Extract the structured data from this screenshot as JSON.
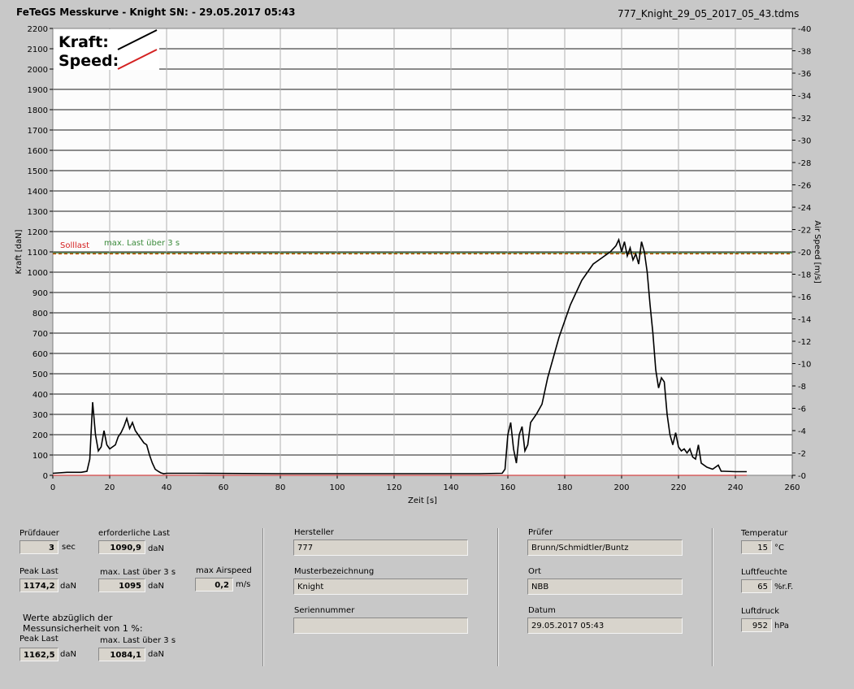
{
  "header": {
    "title": "FeTeGS Messkurve - Knight  SN:  - 29.05.2017 05:43",
    "filename": "777_Knight_29_05_2017_05_43.tdms"
  },
  "legend": {
    "kraft": "Kraft:",
    "speed": "Speed:"
  },
  "annotations": {
    "sollast": "Solllast",
    "maxlast": "max. Last über  3 s"
  },
  "colors": {
    "kraft": "#000000",
    "speed": "#d42020",
    "sollast": "#c84a00",
    "maxlast": "#3a8a3a"
  },
  "chart_data": {
    "type": "line",
    "xlabel": "Zeit [s]",
    "ylabel": "Kraft [daN]",
    "y2label": "Air Speed [m/s]",
    "xlim": [
      0,
      260
    ],
    "ylim": [
      0,
      2200
    ],
    "y2lim": [
      0,
      40
    ],
    "x_ticks": [
      "0",
      "20",
      "40",
      "60",
      "80",
      "100",
      "120",
      "140",
      "160",
      "180",
      "200",
      "220",
      "240",
      "260"
    ],
    "y_ticks": [
      "0",
      "100",
      "200",
      "300",
      "400",
      "500",
      "600",
      "700",
      "800",
      "900",
      "1000",
      "1100",
      "1200",
      "1300",
      "1400",
      "1500",
      "1600",
      "1700",
      "1800",
      "1900",
      "2000",
      "2100",
      "2200"
    ],
    "y2_ticks": [
      "0",
      "2",
      "4",
      "6",
      "8",
      "10",
      "12",
      "14",
      "16",
      "18",
      "20",
      "22",
      "24",
      "26",
      "28",
      "30",
      "32",
      "34",
      "36",
      "38",
      "40"
    ],
    "grid": true,
    "sollast": 1090.9,
    "maxlast": 1095,
    "series": [
      {
        "name": "Kraft",
        "axis": "left",
        "x": [
          0,
          5,
          10,
          12,
          13,
          14,
          15,
          16,
          17,
          18,
          19,
          20,
          21,
          22,
          23,
          24,
          25,
          26,
          27,
          28,
          29,
          30,
          31,
          32,
          33,
          34,
          35,
          36,
          37,
          38,
          39,
          40,
          50,
          80,
          120,
          150,
          158,
          159,
          160,
          161,
          162,
          163,
          164,
          165,
          166,
          167,
          168,
          170,
          172,
          174,
          176,
          178,
          180,
          182,
          184,
          186,
          188,
          190,
          192,
          194,
          196,
          198,
          199,
          200,
          201,
          202,
          203,
          204,
          205,
          206,
          207,
          208,
          209,
          210,
          211,
          212,
          213,
          214,
          215,
          216,
          217,
          218,
          219,
          220,
          221,
          222,
          223,
          224,
          225,
          226,
          227,
          228,
          230,
          232,
          234,
          235,
          236,
          240,
          244
        ],
        "y": [
          10,
          15,
          15,
          20,
          80,
          360,
          200,
          120,
          140,
          220,
          150,
          130,
          140,
          150,
          190,
          210,
          240,
          280,
          230,
          260,
          220,
          200,
          180,
          160,
          150,
          100,
          60,
          30,
          20,
          12,
          8,
          10,
          10,
          8,
          8,
          8,
          10,
          30,
          200,
          260,
          130,
          60,
          200,
          240,
          120,
          150,
          260,
          300,
          350,
          480,
          580,
          680,
          760,
          840,
          900,
          960,
          1000,
          1040,
          1060,
          1080,
          1100,
          1130,
          1160,
          1100,
          1150,
          1080,
          1120,
          1060,
          1090,
          1040,
          1150,
          1100,
          1000,
          840,
          700,
          520,
          430,
          480,
          460,
          300,
          200,
          150,
          210,
          140,
          120,
          130,
          110,
          130,
          90,
          80,
          150,
          60,
          40,
          30,
          50,
          20,
          20,
          18,
          18
        ]
      },
      {
        "name": "Speed",
        "axis": "right",
        "x": [
          0,
          244
        ],
        "y": [
          0,
          0
        ]
      }
    ]
  },
  "panel": {
    "pruefdauer": {
      "label": "Prüfdauer",
      "value": "3",
      "unit": "sec"
    },
    "erf_last": {
      "label": "erforderliche Last",
      "value": "1090,9",
      "unit": "daN"
    },
    "peak_last": {
      "label": "Peak Last",
      "value": "1174,2",
      "unit": "daN"
    },
    "max_last": {
      "label": "max. Last über  3 s",
      "value": "1095",
      "unit": "daN"
    },
    "max_airspeed": {
      "label": "max Airspeed",
      "value": "0,2",
      "unit": "m/s"
    },
    "werte_note_1": "Werte abzüglich der",
    "werte_note_2": "Messunsicherheit von 1   %:",
    "peak_last2": {
      "label": "Peak Last",
      "value": "1162,5",
      "unit": "daN"
    },
    "max_last2": {
      "label": "max. Last über  3 s",
      "value": "1084,1",
      "unit": "daN"
    },
    "hersteller": {
      "label": "Hersteller",
      "value": "777"
    },
    "muster": {
      "label": "Musterbezeichnung",
      "value": "Knight"
    },
    "serien": {
      "label": "Seriennummer",
      "value": ""
    },
    "pruefer": {
      "label": "Prüfer",
      "value": "Brunn/Schmidtler/Buntz"
    },
    "ort": {
      "label": "Ort",
      "value": "NBB"
    },
    "datum": {
      "label": "Datum",
      "value": "29.05.2017 05:43"
    },
    "temperatur": {
      "label": "Temperatur",
      "value": "15",
      "unit": "°C"
    },
    "luftfeuchte": {
      "label": "Luftfeuchte",
      "value": "65",
      "unit": "%r.F."
    },
    "luftdruck": {
      "label": "Luftdruck",
      "value": "952",
      "unit": "hPa"
    }
  }
}
